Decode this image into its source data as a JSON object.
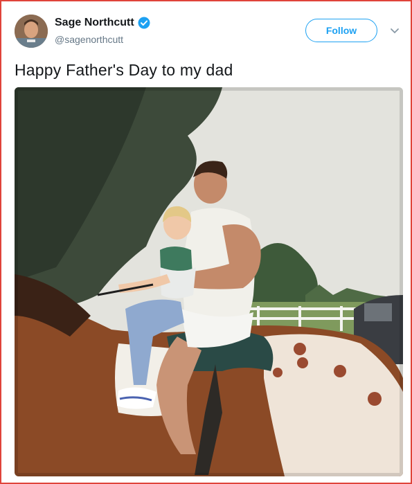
{
  "tweet": {
    "author_name": "Sage Northcutt",
    "author_handle": "@sagenorthcutt",
    "verified": true,
    "text": "Happy Father's Day to my dad"
  },
  "actions": {
    "follow_label": "Follow"
  },
  "icons": {
    "verified": "verified-badge-icon",
    "menu": "chevron-down-icon"
  },
  "colors": {
    "accent": "#1da1f2",
    "name_text": "#14171a",
    "handle_text": "#657786",
    "frame_border": "#e0443a"
  }
}
